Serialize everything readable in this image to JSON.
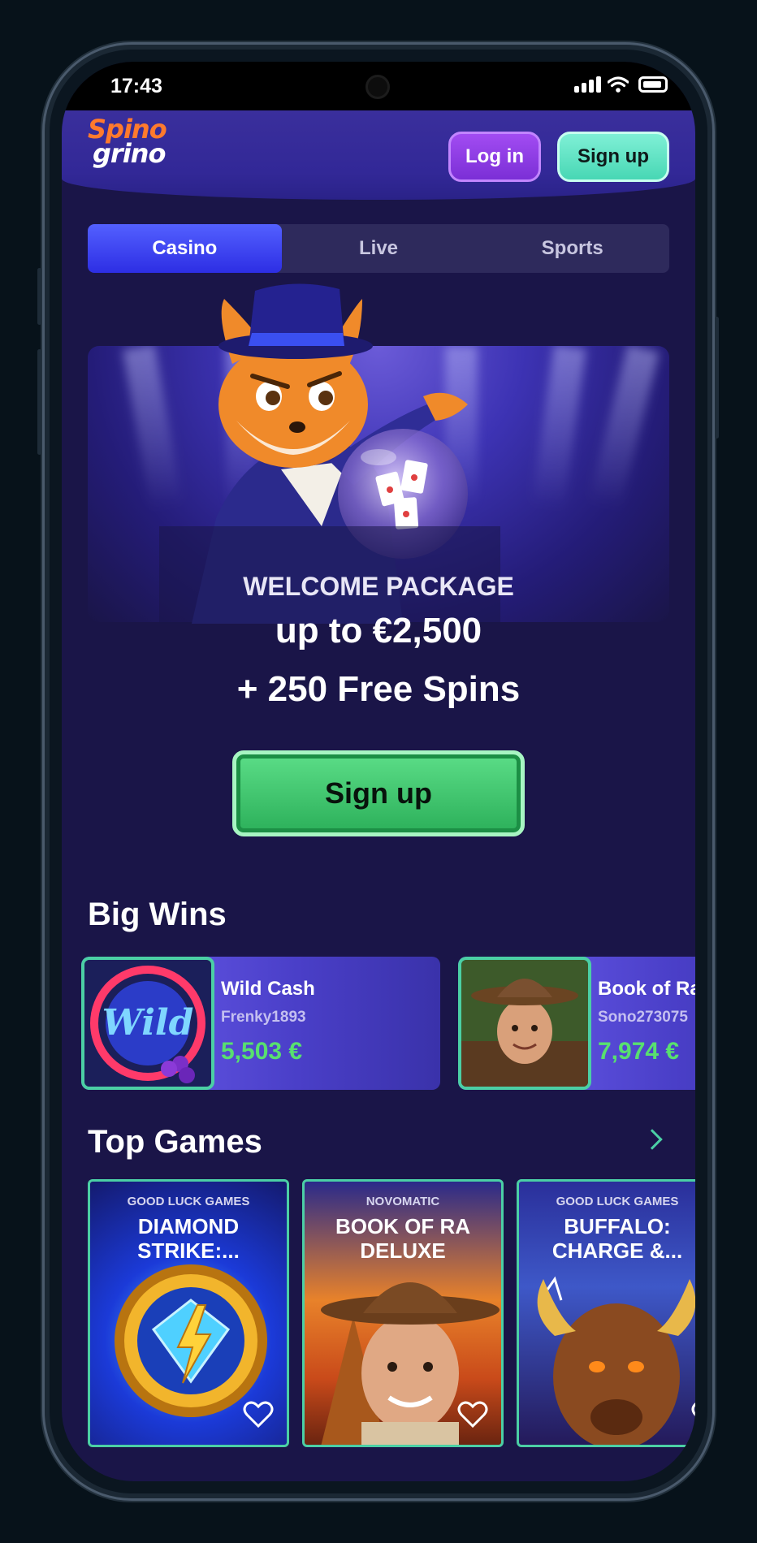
{
  "status_bar": {
    "time": "17:43"
  },
  "header": {
    "logo_line1": "Spino",
    "logo_line2": "grino",
    "login_label": "Log in",
    "signup_label": "Sign up"
  },
  "tabs": [
    {
      "label": "Casino",
      "active": true
    },
    {
      "label": "Live",
      "active": false
    },
    {
      "label": "Sports",
      "active": false
    }
  ],
  "hero": {
    "title": "WELCOME PACKAGE",
    "bonus": "up to €2,500",
    "spins": "+ 250 Free Spins",
    "cta_label": "Sign up"
  },
  "big_wins": {
    "title": "Big Wins",
    "items": [
      {
        "game": "Wild Cash",
        "user": "Frenky1893",
        "amount": "5,503 €"
      },
      {
        "game": "Book of Ra",
        "user": "Sono273075",
        "amount": "7,974 €"
      }
    ]
  },
  "top_games": {
    "title": "Top Games",
    "items": [
      {
        "provider": "GOOD LUCK GAMES",
        "title": "DIAMOND STRIKE:..."
      },
      {
        "provider": "NOVOMATIC",
        "title": "BOOK OF RA DELUXE"
      },
      {
        "provider": "GOOD LUCK GAMES",
        "title": "BUFFALO: CHARGE &..."
      }
    ]
  },
  "colors": {
    "background": "#1a1548",
    "accent_green": "#58e06f",
    "accent_teal": "#4bcfa5",
    "tab_active": "#3d3ff0",
    "login_purple": "#8c3ae4",
    "brand_orange": "#ff7a2d"
  },
  "icons": [
    "signal-icon",
    "wifi-icon",
    "battery-icon",
    "chevron-right-icon",
    "heart-icon"
  ]
}
